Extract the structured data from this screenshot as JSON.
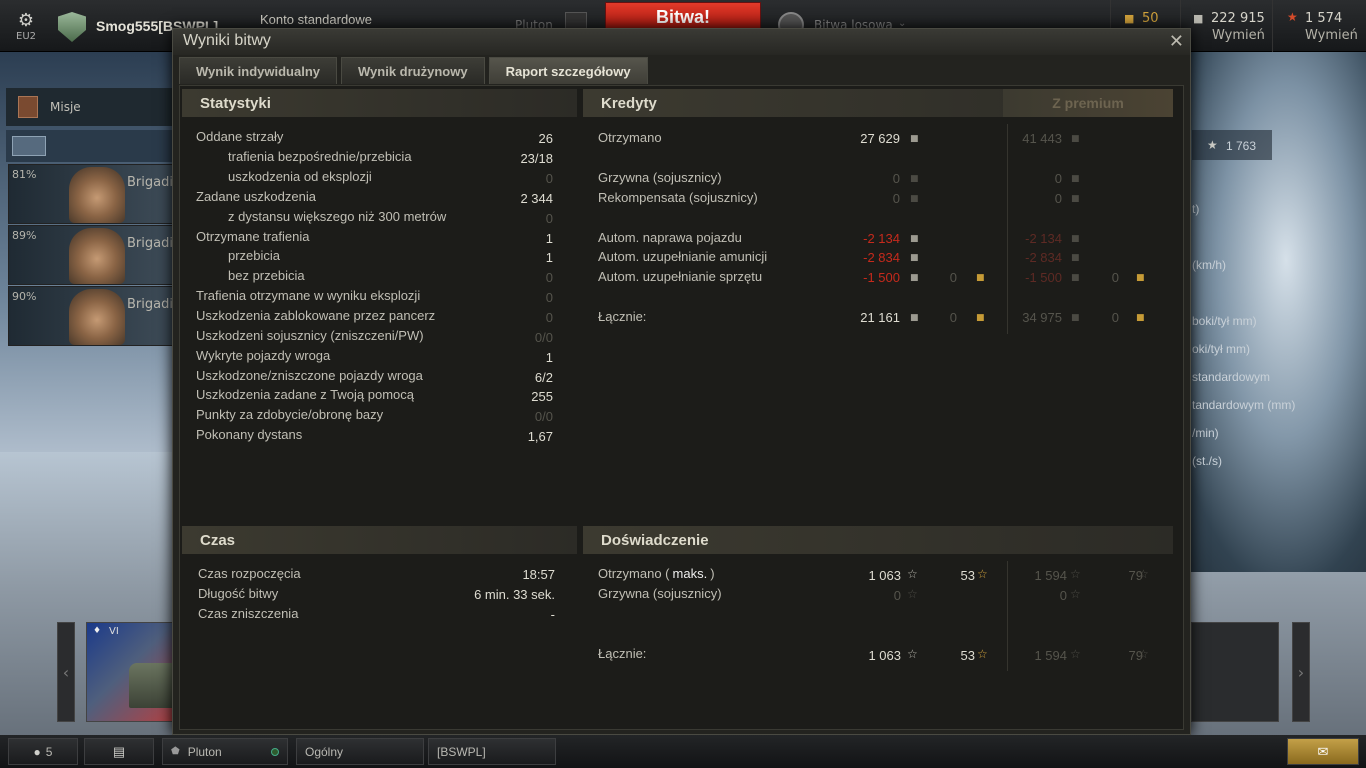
{
  "topbar": {
    "region": "EU2",
    "player": "Smog555[BSWPL]",
    "account_type": "Konto standardowe",
    "platoon": "Pluton",
    "battle_button": "Bitwa!",
    "battle_mode": "Bitwa losowa",
    "gold": "50",
    "credits": "222 915",
    "credits_action": "Wymień",
    "free_xp": "1 574",
    "free_xp_action": "Wymień"
  },
  "sidebar": {
    "missions": "Misje",
    "crew": [
      {
        "pct": "81%",
        "rank": "Brigadier"
      },
      {
        "pct": "89%",
        "rank": "Brigadier"
      },
      {
        "pct": "90%",
        "rank": "Brigadier"
      }
    ]
  },
  "right_panel": {
    "xp": "1 763",
    "labels": [
      "t)",
      "(km/h)",
      "boki/tył mm)",
      "oki/tył mm)",
      "standardowym",
      "tandardowym (mm)",
      "/min)",
      "(st./s)"
    ]
  },
  "tank": {
    "tier": "VI"
  },
  "modal": {
    "title": "Wyniki bitwy",
    "tabs": [
      "Wynik indywidualny",
      "Wynik drużynowy",
      "Raport szczegółowy"
    ],
    "active_tab": 2,
    "stats": {
      "header": "Statystyki",
      "rows": [
        {
          "label": "Oddane strzały",
          "value": "26",
          "indent": false,
          "dim": false
        },
        {
          "label": "trafienia bezpośrednie/przebicia",
          "value": "23/18",
          "indent": true,
          "dim": false
        },
        {
          "label": "uszkodzenia od eksplozji",
          "value": "0",
          "indent": true,
          "dim": true
        },
        {
          "label": "Zadane uszkodzenia",
          "value": "2 344",
          "indent": false,
          "dim": false
        },
        {
          "label": "z dystansu większego niż 300 metrów",
          "value": "0",
          "indent": true,
          "dim": true
        },
        {
          "label": "Otrzymane trafienia",
          "value": "1",
          "indent": false,
          "dim": false
        },
        {
          "label": "przebicia",
          "value": "1",
          "indent": true,
          "dim": false
        },
        {
          "label": "bez przebicia",
          "value": "0",
          "indent": true,
          "dim": true
        },
        {
          "label": "Trafienia otrzymane w wyniku eksplozji",
          "value": "0",
          "indent": false,
          "dim": true
        },
        {
          "label": "Uszkodzenia zablokowane przez pancerz",
          "value": "0",
          "indent": false,
          "dim": true
        },
        {
          "label": "Uszkodzeni sojusznicy (zniszczeni/PW)",
          "value": "0/0",
          "indent": false,
          "dim": true
        },
        {
          "label": "Wykryte pojazdy wroga",
          "value": "1",
          "indent": false,
          "dim": false
        },
        {
          "label": "Uszkodzone/zniszczone pojazdy wroga",
          "value": "6/2",
          "indent": false,
          "dim": false
        },
        {
          "label": "Uszkodzenia zadane z Twoją pomocą",
          "value": "255",
          "indent": false,
          "dim": false
        },
        {
          "label": "Punkty za zdobycie/obronę bazy",
          "value": "0/0",
          "indent": false,
          "dim": true
        },
        {
          "label": "Pokonany dystans",
          "value": "1,67",
          "indent": false,
          "dim": false
        }
      ]
    },
    "credits": {
      "header": "Kredyty",
      "premium_header": "Z premium",
      "rows": [
        {
          "label": "Otrzymano",
          "value": "27 629",
          "gold": null,
          "premium": "41 443",
          "premium_gold": null,
          "type": "bright"
        },
        {
          "label": "Grzywna (sojusznicy)",
          "value": "0",
          "gold": null,
          "premium": "0",
          "premium_gold": null,
          "type": "dim"
        },
        {
          "label": "Rekompensata (sojusznicy)",
          "value": "0",
          "gold": null,
          "premium": "0",
          "premium_gold": null,
          "type": "dim"
        },
        {
          "label": "Autom. naprawa pojazdu",
          "value": "-2 134",
          "gold": null,
          "premium": "-2 134",
          "premium_gold": null,
          "type": "neg"
        },
        {
          "label": "Autom. uzupełnianie amunicji",
          "value": "-2 834",
          "gold": null,
          "premium": "-2 834",
          "premium_gold": null,
          "type": "neg"
        },
        {
          "label": "Autom. uzupełnianie sprzętu",
          "value": "-1 500",
          "gold": "0",
          "premium": "-1 500",
          "premium_gold": "0",
          "type": "neg"
        },
        {
          "label": "Łącznie:",
          "value": "21 161",
          "gold": "0",
          "premium": "34 975",
          "premium_gold": "0",
          "type": "bright"
        }
      ]
    },
    "time": {
      "header": "Czas",
      "rows": [
        {
          "label": "Czas rozpoczęcia",
          "value": "18:57"
        },
        {
          "label": "Długość bitwy",
          "value": "6 min. 33 sek."
        },
        {
          "label": "Czas zniszczenia",
          "value": "-"
        }
      ]
    },
    "experience": {
      "header": "Doświadczenie",
      "rows": [
        {
          "label_pre": "Otrzymano (",
          "label_bold": "maks.",
          "label_post": ")",
          "xp": "1 063",
          "free": "53",
          "premium_xp": "1 594",
          "premium_free": "79",
          "type": "bright"
        },
        {
          "label_pre": "Grzywna (sojusznicy)",
          "label_bold": "",
          "label_post": "",
          "xp": "0",
          "free": null,
          "premium_xp": "0",
          "premium_free": null,
          "type": "dim"
        },
        {
          "label_pre": "Łącznie:",
          "label_bold": "",
          "label_post": "",
          "xp": "1 063",
          "free": "53",
          "premium_xp": "1 594",
          "premium_free": "79",
          "type": "bright"
        }
      ]
    }
  },
  "bottombar": {
    "online_count": "5",
    "channel_1": "Pluton",
    "channel_2": "Ogólny",
    "channel_3": "[BSWPL]"
  },
  "colors": {
    "accent_red": "#c62a1c",
    "gold": "#c69b36",
    "battle_button": "#c21c12"
  }
}
